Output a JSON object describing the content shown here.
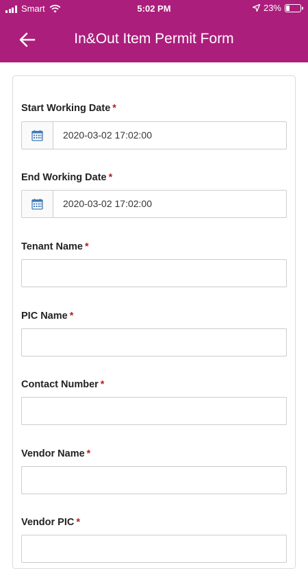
{
  "status_bar": {
    "carrier": "Smart",
    "time": "5:02 PM",
    "battery": "23%",
    "battery_level": 0.23
  },
  "header": {
    "title": "In&Out Item Permit Form"
  },
  "form": {
    "required_mark": "*",
    "fields": [
      {
        "label": "Start Working Date",
        "value": "2020-03-02 17:02:00"
      },
      {
        "label": "End Working Date",
        "value": "2020-03-02 17:02:00"
      },
      {
        "label": "Tenant Name",
        "value": ""
      },
      {
        "label": "PIC Name",
        "value": ""
      },
      {
        "label": "Contact Number",
        "value": ""
      },
      {
        "label": "Vendor Name",
        "value": ""
      },
      {
        "label": "Vendor PIC",
        "value": ""
      }
    ]
  },
  "colors": {
    "header_bg": "#ac1e7c",
    "required": "#b22323",
    "calendar_icon": "#3d7ab8"
  },
  "icons": {
    "back": "back-arrow-icon",
    "calendar": "calendar-icon",
    "signal": "signal-icon",
    "wifi": "wifi-icon",
    "location": "location-arrow-icon",
    "battery": "battery-icon"
  }
}
